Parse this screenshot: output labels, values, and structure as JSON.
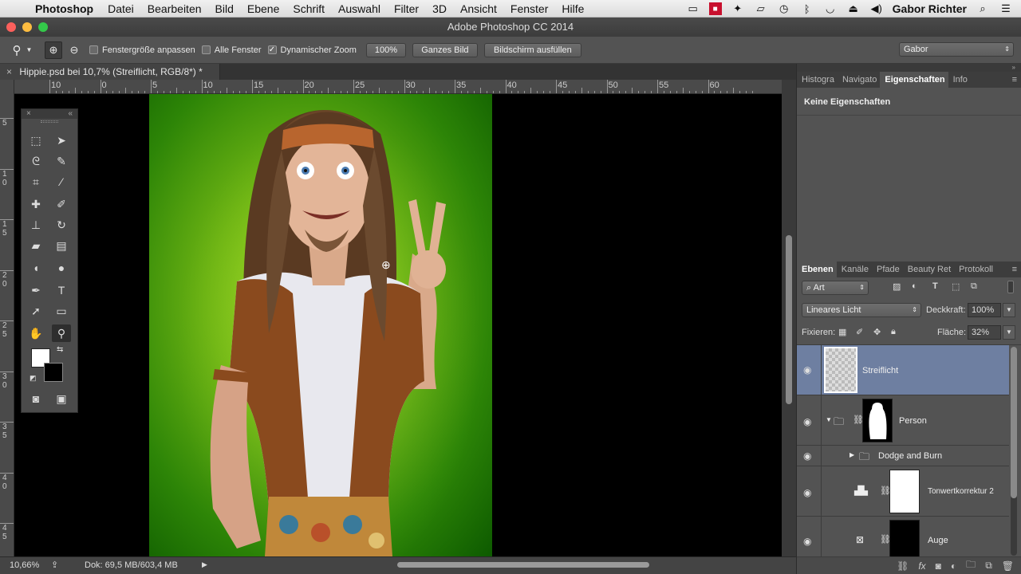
{
  "menubar": {
    "apple_icon": "apple-icon",
    "app_name": "Photoshop",
    "items": [
      "Datei",
      "Bearbeiten",
      "Bild",
      "Ebene",
      "Schrift",
      "Auswahl",
      "Filter",
      "3D",
      "Ansicht",
      "Fenster",
      "Hilfe"
    ],
    "user": "Gabor Richter"
  },
  "window": {
    "title": "Adobe Photoshop CC 2014"
  },
  "options": {
    "fit_window": "Fenstergröße anpassen",
    "all_windows": "Alle Fenster",
    "dynamic_zoom": "Dynamischer Zoom",
    "dynamic_zoom_checked": true,
    "btn_100": "100%",
    "btn_whole": "Ganzes Bild",
    "btn_fill": "Bildschirm ausfüllen",
    "workspace": "Gabor"
  },
  "document": {
    "tab_title": "Hippie.psd bei 10,7% (Streiflicht, RGB/8*) *",
    "close": "×"
  },
  "rulers": {
    "h_labels": [
      "10",
      "0",
      "5",
      "10",
      "15",
      "20",
      "25",
      "30",
      "35",
      "40",
      "45",
      "50",
      "55",
      "60"
    ],
    "v_labels": [
      "5",
      "1\n0",
      "1\n5",
      "2\n0",
      "2\n5",
      "3\n0",
      "3\n5",
      "4\n0",
      "4\n5"
    ]
  },
  "status": {
    "zoom": "10,66%",
    "doc_info": "Dok: 69,5 MB/603,4 MB"
  },
  "toolbox": {
    "close": "×",
    "collapse": "«"
  },
  "properties": {
    "tabs": [
      "Histogra",
      "Navigato",
      "Eigenschaften",
      "Info"
    ],
    "active_tab": "Eigenschaften",
    "content": "Keine Eigenschaften"
  },
  "layers_panel": {
    "tabs": [
      "Ebenen",
      "Kanäle",
      "Pfade",
      "Beauty Ret",
      "Protokoll"
    ],
    "active_tab": "Ebenen",
    "filter": "Art",
    "blend_mode": "Lineares Licht",
    "opacity_label": "Deckkraft:",
    "opacity": "100%",
    "lock_label": "Fixieren:",
    "fill_label": "Fläche:",
    "fill": "32%",
    "layers": [
      {
        "name": "Streiflicht",
        "selected": true
      },
      {
        "name": "Person"
      },
      {
        "name": "Dodge and Burn"
      },
      {
        "name": "Tonwertkorrektur 2"
      },
      {
        "name": "Auge"
      }
    ]
  },
  "colors": {
    "accent_selected": "#6e7fa1",
    "green_bg": "#4fa10f"
  }
}
